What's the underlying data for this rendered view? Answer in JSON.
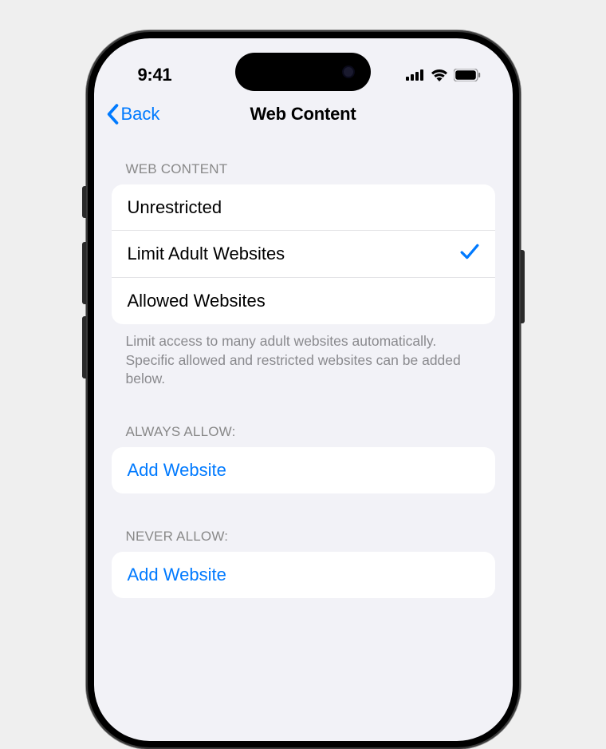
{
  "statusBar": {
    "time": "9:41"
  },
  "nav": {
    "backLabel": "Back",
    "title": "Web Content"
  },
  "sections": {
    "webContent": {
      "header": "Web Content",
      "options": {
        "unrestricted": "Unrestricted",
        "limitAdult": "Limit Adult Websites",
        "allowedOnly": "Allowed Websites"
      },
      "selected": "limitAdult",
      "footer": "Limit access to many adult websites automatically. Specific allowed and restricted websites can be added below."
    },
    "alwaysAllow": {
      "header": "Always Allow:",
      "addLabel": "Add Website"
    },
    "neverAllow": {
      "header": "Never Allow:",
      "addLabel": "Add Website"
    }
  },
  "colors": {
    "accent": "#007aff",
    "background": "#f2f2f7",
    "card": "#ffffff",
    "secondaryText": "#8a8a8e"
  }
}
